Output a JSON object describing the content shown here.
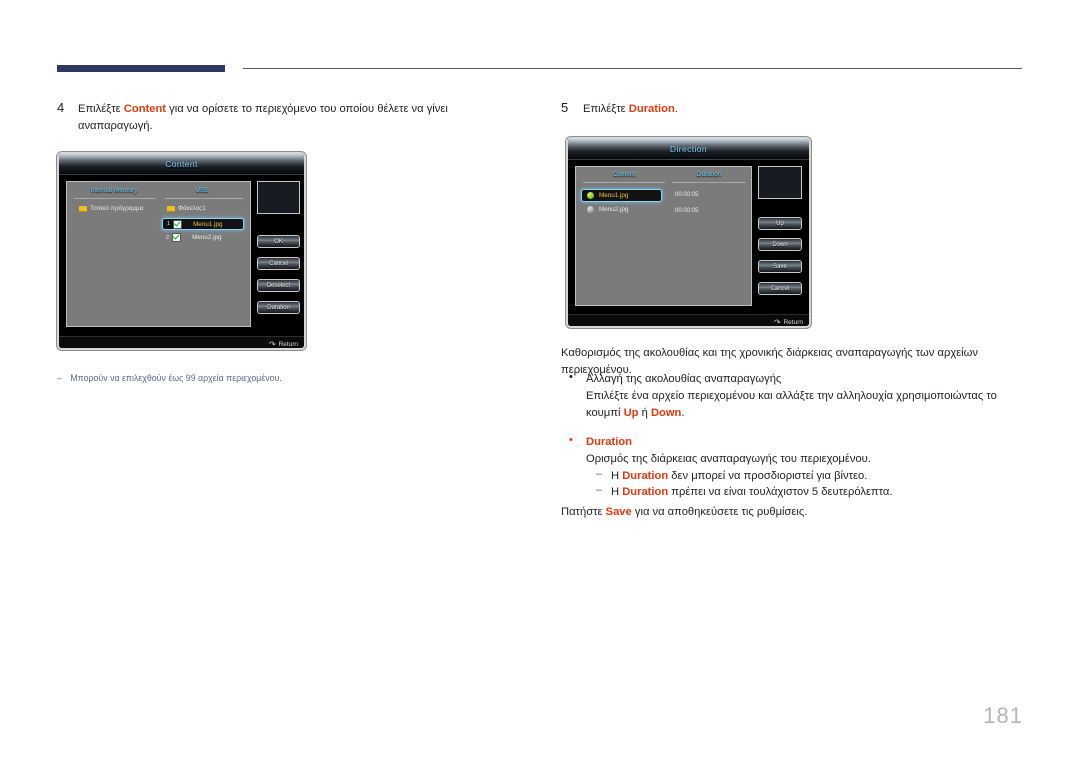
{
  "page": {
    "number": "181"
  },
  "steps": {
    "four": {
      "num": "4",
      "line1_pre": "Επιλέξτε ",
      "line1_kw": "Content",
      "line1_post": " για να ορίσετε το περιεχόμενο του οποίου θέλετε να γίνει",
      "line2": "αναπαραγωγή."
    },
    "five": {
      "num": "5",
      "pre": "Επιλέξτε ",
      "kw": "Duration",
      "post": "."
    }
  },
  "note_left": {
    "dash": "–",
    "text": "Μπορούν να επιλεχθούν έως 99 αρχεία περιεχομένου."
  },
  "content_dialog": {
    "title": "Content",
    "tabs": [
      {
        "label": "Internal Memory"
      },
      {
        "label": "USB"
      }
    ],
    "internal_items": [
      {
        "label": "Τοπικό πρόγραμμα",
        "icon": "folder-icon"
      }
    ],
    "usb_items": [
      {
        "index": "",
        "label": "Φάκελος1",
        "icon": "folder-icon",
        "selected": false,
        "checked": false
      },
      {
        "index": "1",
        "label": "Menu1.jpg",
        "icon": "checkbox-icon",
        "selected": true,
        "checked": true
      },
      {
        "index": "2",
        "label": "Menu2.jpg",
        "icon": "checkbox-icon",
        "selected": false,
        "checked": true
      }
    ],
    "buttons": [
      {
        "label": "OK"
      },
      {
        "label": "Cancel"
      },
      {
        "label": "Deselect"
      },
      {
        "label": "Duration"
      }
    ],
    "footer": {
      "label": "Return",
      "icon": "return-arrow-icon"
    }
  },
  "direction_dialog": {
    "title": "Direction",
    "columns": [
      {
        "label": "Content"
      },
      {
        "label": "Duration"
      }
    ],
    "rows": [
      {
        "label": "Menu1.jpg",
        "duration": "00:00:05",
        "icon": "green-dot-icon",
        "selected": true
      },
      {
        "label": "Menu2.jpg",
        "duration": "00:00:05",
        "icon": "gray-item-icon",
        "selected": false
      }
    ],
    "buttons": [
      {
        "label": "Up"
      },
      {
        "label": "Down"
      },
      {
        "label": "Save"
      },
      {
        "label": "Cancel"
      }
    ],
    "footer": {
      "label": "Return",
      "icon": "return-arrow-icon"
    }
  },
  "right_body": {
    "intro_l1": "Καθορισμός της ακολουθίας και της χρονικής διάρκειας αναπαραγωγής των αρχείων",
    "intro_l2": "περιεχομένου.",
    "bullet1": {
      "dot": "•",
      "title": "Αλλαγή της ακολουθίας αναπαραγωγής",
      "l1": "Επιλέξτε ένα αρχείο περιεχομένου και αλλάξτε την αλληλουχία χρησιμοποιώντας το",
      "l2_pre": "κουμπί ",
      "l2_kw1": "Up",
      "l2_mid": " ή ",
      "l2_kw2": "Down",
      "l2_post": "."
    },
    "bullet2": {
      "dot": "•",
      "title": "Duration",
      "l1": "Ορισμός της διάρκειας αναπαραγωγής του περιεχομένου.",
      "sub1": {
        "dash": "–",
        "pre": "Η ",
        "kw": "Duration",
        "post": " δεν μπορεί να προσδιοριστεί για βίντεο."
      },
      "sub2": {
        "dash": "–",
        "pre": "Η ",
        "kw": "Duration",
        "post": " πρέπει να είναι τουλάχιστον 5 δευτερόλεπτα."
      }
    },
    "closing": {
      "pre": "Πατήστε ",
      "kw": "Save",
      "post": " για να αποθηκεύσετε τις ρυθμίσεις."
    }
  },
  "colors": {
    "keyword": "#e8380d",
    "header_bar": "#2e3963",
    "note": "#5b6a8f",
    "osd_title": "#7fd0ff",
    "page_number": "#b6b6b6"
  }
}
